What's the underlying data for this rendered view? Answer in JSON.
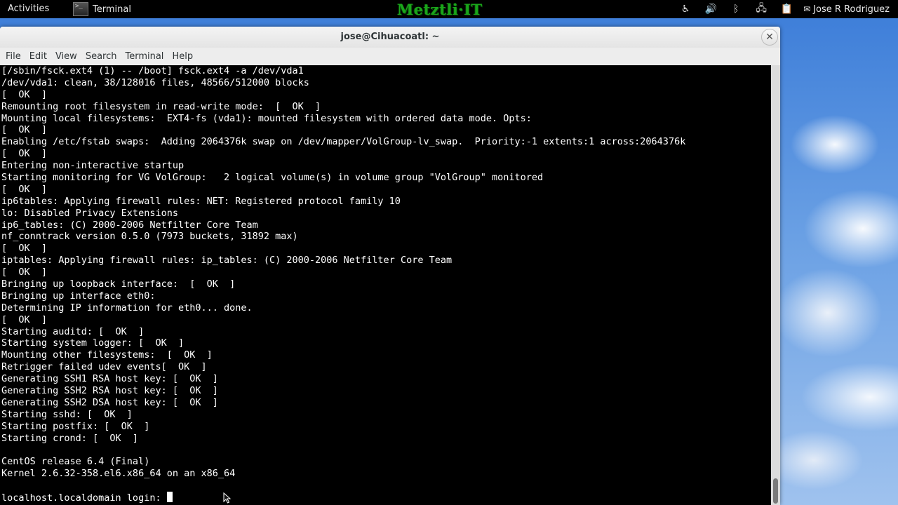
{
  "topbar": {
    "activities": "Activities",
    "app_name": "Terminal",
    "brand": "Metztli·IT",
    "tray_icons": [
      "accessibility-icon",
      "volume-icon",
      "bluetooth-icon",
      "network-icon",
      "clipboard-icon"
    ],
    "user_name": "Jose R Rodriguez"
  },
  "window": {
    "title": "jose@Cihuacoatl: ~",
    "menu": [
      "File",
      "Edit",
      "View",
      "Search",
      "Terminal",
      "Help"
    ]
  },
  "terminal": {
    "lines": [
      "[/sbin/fsck.ext4 (1) -- /boot] fsck.ext4 -a /dev/vda1",
      "/dev/vda1: clean, 38/128016 files, 48566/512000 blocks",
      "[  OK  ]",
      "Remounting root filesystem in read-write mode:  [  OK  ]",
      "Mounting local filesystems:  EXT4-fs (vda1): mounted filesystem with ordered data mode. Opts:",
      "[  OK  ]",
      "Enabling /etc/fstab swaps:  Adding 2064376k swap on /dev/mapper/VolGroup-lv_swap.  Priority:-1 extents:1 across:2064376k",
      "[  OK  ]",
      "Entering non-interactive startup",
      "Starting monitoring for VG VolGroup:   2 logical volume(s) in volume group \"VolGroup\" monitored",
      "[  OK  ]",
      "ip6tables: Applying firewall rules: NET: Registered protocol family 10",
      "lo: Disabled Privacy Extensions",
      "ip6_tables: (C) 2000-2006 Netfilter Core Team",
      "nf_conntrack version 0.5.0 (7973 buckets, 31892 max)",
      "[  OK  ]",
      "iptables: Applying firewall rules: ip_tables: (C) 2000-2006 Netfilter Core Team",
      "[  OK  ]",
      "Bringing up loopback interface:  [  OK  ]",
      "Bringing up interface eth0:",
      "Determining IP information for eth0... done.",
      "[  OK  ]",
      "Starting auditd: [  OK  ]",
      "Starting system logger: [  OK  ]",
      "Mounting other filesystems:  [  OK  ]",
      "Retrigger failed udev events[  OK  ]",
      "Generating SSH1 RSA host key: [  OK  ]",
      "Generating SSH2 RSA host key: [  OK  ]",
      "Generating SSH2 DSA host key: [  OK  ]",
      "Starting sshd: [  OK  ]",
      "Starting postfix: [  OK  ]",
      "Starting crond: [  OK  ]",
      "",
      "CentOS release 6.4 (Final)",
      "Kernel 2.6.32-358.el6.x86_64 on an x86_64",
      ""
    ],
    "prompt": "localhost.localdomain login: "
  }
}
